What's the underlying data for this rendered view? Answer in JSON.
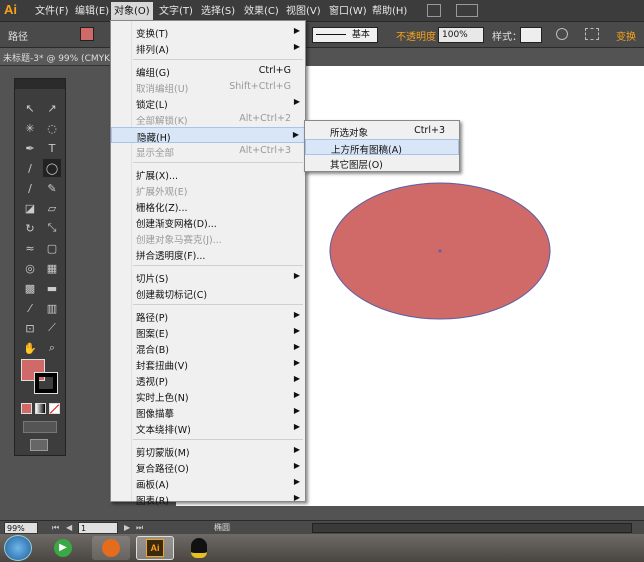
{
  "app": {
    "logo": "Ai"
  },
  "menubar": {
    "items": [
      "文件(F)",
      "编辑(E)",
      "对象(O)",
      "文字(T)",
      "选择(S)",
      "效果(C)",
      "视图(V)",
      "窗口(W)",
      "帮助(H)"
    ],
    "active_index": 2
  },
  "controlbar": {
    "selection_label": "路径",
    "fill_color": "#d06a68",
    "stroke_style_label": "基本",
    "opacity_label": "不透明度",
    "opacity_value": "100%",
    "style_label": "样式：",
    "right_label": "变换"
  },
  "document": {
    "tab_title": "未标题-3* @ 99% (CMYK"
  },
  "object_menu": {
    "items": [
      {
        "label": "变换(T)",
        "shortcut": "",
        "submenu": true,
        "disabled": false
      },
      {
        "label": "排列(A)",
        "shortcut": "",
        "submenu": true,
        "disabled": false
      },
      {
        "sep": true
      },
      {
        "label": "编组(G)",
        "shortcut": "Ctrl+G",
        "submenu": false,
        "disabled": false
      },
      {
        "label": "取消编组(U)",
        "shortcut": "Shift+Ctrl+G",
        "submenu": false,
        "disabled": true
      },
      {
        "label": "锁定(L)",
        "shortcut": "",
        "submenu": true,
        "disabled": false
      },
      {
        "label": "全部解锁(K)",
        "shortcut": "Alt+Ctrl+2",
        "submenu": false,
        "disabled": true
      },
      {
        "label": "隐藏(H)",
        "shortcut": "",
        "submenu": true,
        "disabled": false,
        "highlight": true
      },
      {
        "label": "显示全部",
        "shortcut": "Alt+Ctrl+3",
        "submenu": false,
        "disabled": true
      },
      {
        "sep": true
      },
      {
        "label": "扩展(X)...",
        "shortcut": "",
        "submenu": false,
        "disabled": false
      },
      {
        "label": "扩展外观(E)",
        "shortcut": "",
        "submenu": false,
        "disabled": true
      },
      {
        "label": "栅格化(Z)...",
        "shortcut": "",
        "submenu": false,
        "disabled": false
      },
      {
        "label": "创建渐变网格(D)...",
        "shortcut": "",
        "submenu": false,
        "disabled": false
      },
      {
        "label": "创建对象马赛克(J)...",
        "shortcut": "",
        "submenu": false,
        "disabled": true
      },
      {
        "label": "拼合透明度(F)...",
        "shortcut": "",
        "submenu": false,
        "disabled": false
      },
      {
        "sep": true
      },
      {
        "label": "切片(S)",
        "shortcut": "",
        "submenu": true,
        "disabled": false
      },
      {
        "label": "创建裁切标记(C)",
        "shortcut": "",
        "submenu": false,
        "disabled": false
      },
      {
        "sep": true
      },
      {
        "label": "路径(P)",
        "shortcut": "",
        "submenu": true,
        "disabled": false
      },
      {
        "label": "图案(E)",
        "shortcut": "",
        "submenu": true,
        "disabled": false
      },
      {
        "label": "混合(B)",
        "shortcut": "",
        "submenu": true,
        "disabled": false
      },
      {
        "label": "封套扭曲(V)",
        "shortcut": "",
        "submenu": true,
        "disabled": false
      },
      {
        "label": "透视(P)",
        "shortcut": "",
        "submenu": true,
        "disabled": false
      },
      {
        "label": "实时上色(N)",
        "shortcut": "",
        "submenu": true,
        "disabled": false
      },
      {
        "label": "图像描摹",
        "shortcut": "",
        "submenu": true,
        "disabled": false
      },
      {
        "label": "文本绕排(W)",
        "shortcut": "",
        "submenu": true,
        "disabled": false
      },
      {
        "sep": true
      },
      {
        "label": "剪切蒙版(M)",
        "shortcut": "",
        "submenu": true,
        "disabled": false
      },
      {
        "label": "复合路径(O)",
        "shortcut": "",
        "submenu": true,
        "disabled": false
      },
      {
        "label": "画板(A)",
        "shortcut": "",
        "submenu": true,
        "disabled": false
      },
      {
        "label": "图表(R)",
        "shortcut": "",
        "submenu": true,
        "disabled": false
      }
    ]
  },
  "hide_submenu": {
    "items": [
      {
        "label": "所选对象",
        "shortcut": "Ctrl+3",
        "highlight": false
      },
      {
        "label": "上方所有图稿(A)",
        "shortcut": "",
        "highlight": true
      },
      {
        "label": "其它图层(O)",
        "shortcut": "",
        "highlight": false
      }
    ]
  },
  "artwork": {
    "ellipse_fill": "#d06a68",
    "ellipse_stroke": "#5b5ea6"
  },
  "toolbox": {
    "fill_swatch": "#d06a68",
    "stroke_swatch": "#000000"
  },
  "statusbar": {
    "zoom": "99%",
    "page": "1",
    "tool_name": "椭圆"
  }
}
